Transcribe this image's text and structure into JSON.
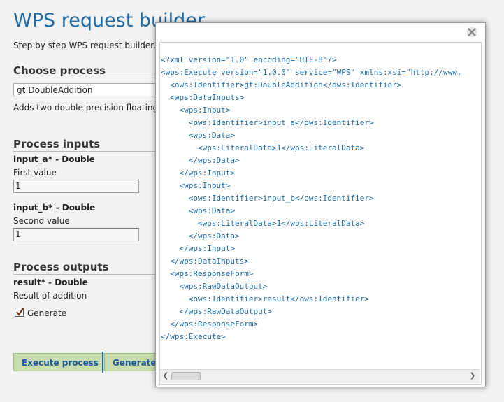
{
  "page": {
    "title": "WPS request builder",
    "subtitle": "Step by step WPS request builder."
  },
  "choose_process": {
    "heading": "Choose process",
    "selected": "gt:DoubleAddition",
    "description": "Adds two double precision floating"
  },
  "process_inputs": {
    "heading": "Process inputs",
    "inputs": [
      {
        "name": "input_a* - Double",
        "label": "First value",
        "value": "1"
      },
      {
        "name": "input_b* - Double",
        "label": "Second value",
        "value": "1"
      }
    ]
  },
  "process_outputs": {
    "heading": "Process outputs",
    "result_name": "result* - Double",
    "result_desc": "Result of addition",
    "generate_label": "Generate",
    "generate_checked": true
  },
  "buttons": {
    "execute": "Execute process",
    "generate_xml": "Generate X"
  },
  "dialog": {
    "close_icon": "close-x-icon",
    "xml_lines": [
      "<?xml version=\"1.0\" encoding=\"UTF-8\"?>",
      "<wps:Execute version=\"1.0.0\" service=\"WPS\" xmlns:xsi=\"http://www.",
      "  <ows:Identifier>gt:DoubleAddition</ows:Identifier>",
      "  <wps:DataInputs>",
      "    <wps:Input>",
      "      <ows:Identifier>input_a</ows:Identifier>",
      "      <wps:Data>",
      "        <wps:LiteralData>1</wps:LiteralData>",
      "      </wps:Data>",
      "    </wps:Input>",
      "    <wps:Input>",
      "      <ows:Identifier>input_b</ows:Identifier>",
      "      <wps:Data>",
      "        <wps:LiteralData>1</wps:LiteralData>",
      "      </wps:Data>",
      "    </wps:Input>",
      "  </wps:DataInputs>",
      "  <wps:ResponseForm>",
      "    <wps:RawDataOutput>",
      "      <ows:Identifier>result</ows:Identifier>",
      "    </wps:RawDataOutput>",
      "  </wps:ResponseForm>",
      "</wps:Execute>"
    ]
  }
}
